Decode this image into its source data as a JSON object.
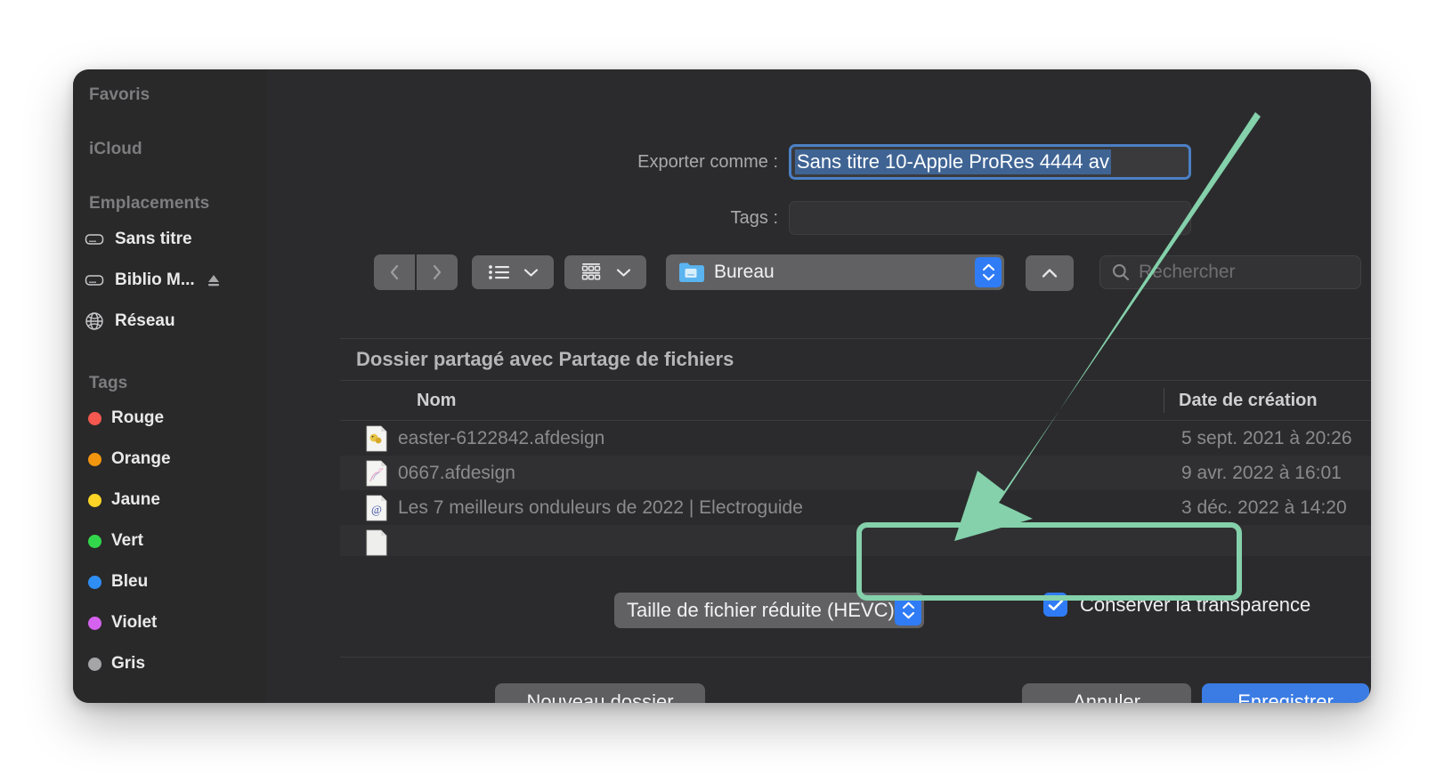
{
  "dialog": {
    "title_not_shown": "",
    "export_label": "Exporter comme :",
    "export_value": "Sans titre 10-Apple ProRes 4444 av",
    "tags_label": "Tags :",
    "tags_value": ""
  },
  "sidebar": {
    "groups": [
      {
        "title": "Favoris",
        "items": []
      },
      {
        "title": "iCloud",
        "items": []
      },
      {
        "title": "Emplacements",
        "items": [
          {
            "label": "Sans titre",
            "icon": "disk-icon",
            "eject": false
          },
          {
            "label": "Biblio M...",
            "icon": "disk-icon",
            "eject": true
          },
          {
            "label": "Réseau",
            "icon": "globe-icon",
            "eject": false
          }
        ]
      },
      {
        "title": "Tags",
        "items": [
          {
            "label": "Rouge",
            "icon": "tag-dot-icon",
            "color": "#f4584f"
          },
          {
            "label": "Orange",
            "icon": "tag-dot-icon",
            "color": "#f2960f"
          },
          {
            "label": "Jaune",
            "icon": "tag-dot-icon",
            "color": "#fbd426"
          },
          {
            "label": "Vert",
            "icon": "tag-dot-icon",
            "color": "#32d74b"
          },
          {
            "label": "Bleu",
            "icon": "tag-dot-icon",
            "color": "#2f8ef4"
          },
          {
            "label": "Violet",
            "icon": "tag-dot-icon",
            "color": "#d562ee"
          },
          {
            "label": "Gris",
            "icon": "tag-dot-icon",
            "color": "#a5a5a8"
          }
        ]
      }
    ]
  },
  "toolbar": {
    "back_icon": "chevron-left-icon",
    "forward_icon": "chevron-right-icon",
    "list_view_icon": "list-view-icon",
    "icon_view_icon": "grid-view-icon",
    "path_label": "Bureau",
    "path_icon": "folder-icon",
    "up_icon": "chevron-up-icon",
    "search_placeholder": "Rechercher",
    "search_value": "",
    "search_icon": "search-icon"
  },
  "file_list": {
    "group_header": "Dossier partagé avec Partage de fichiers",
    "columns": [
      "Nom",
      "Date de création"
    ],
    "rows": [
      {
        "name": "easter-6122842.afdesign",
        "date": "5 sept. 2021 à 20:26",
        "icon": "afdesign-file-icon"
      },
      {
        "name": "0667.afdesign",
        "date": "9 avr. 2022 à 16:01",
        "icon": "afdesign-file-icon"
      },
      {
        "name": "Les 7 meilleurs onduleurs de 2022 | Electroguide",
        "date": "3 déc. 2022 à 14:20",
        "icon": "webloc-file-icon"
      },
      {
        "name": "",
        "date": "",
        "icon": "generic-file-icon"
      }
    ]
  },
  "options": {
    "format_label": "Taille de fichier réduite (HEVC)",
    "checkbox_label": "Conserver la transparence",
    "checkbox_checked": true
  },
  "buttons": {
    "new_folder": "Nouveau dossier",
    "cancel": "Annuler",
    "save": "Enregistrer"
  },
  "colors": {
    "accent_blue": "#2f7cf6",
    "save_blue": "#3b7ce4",
    "annotation_green": "#84d1ab",
    "dialog_bg": "#2b2b2d",
    "sidebar_bg": "#292929",
    "selection_blue": "#3f6494"
  },
  "annotation": {
    "highlight_shape": "rounded-rectangle",
    "arrow_shape": "arrow-pointing-down-left"
  }
}
